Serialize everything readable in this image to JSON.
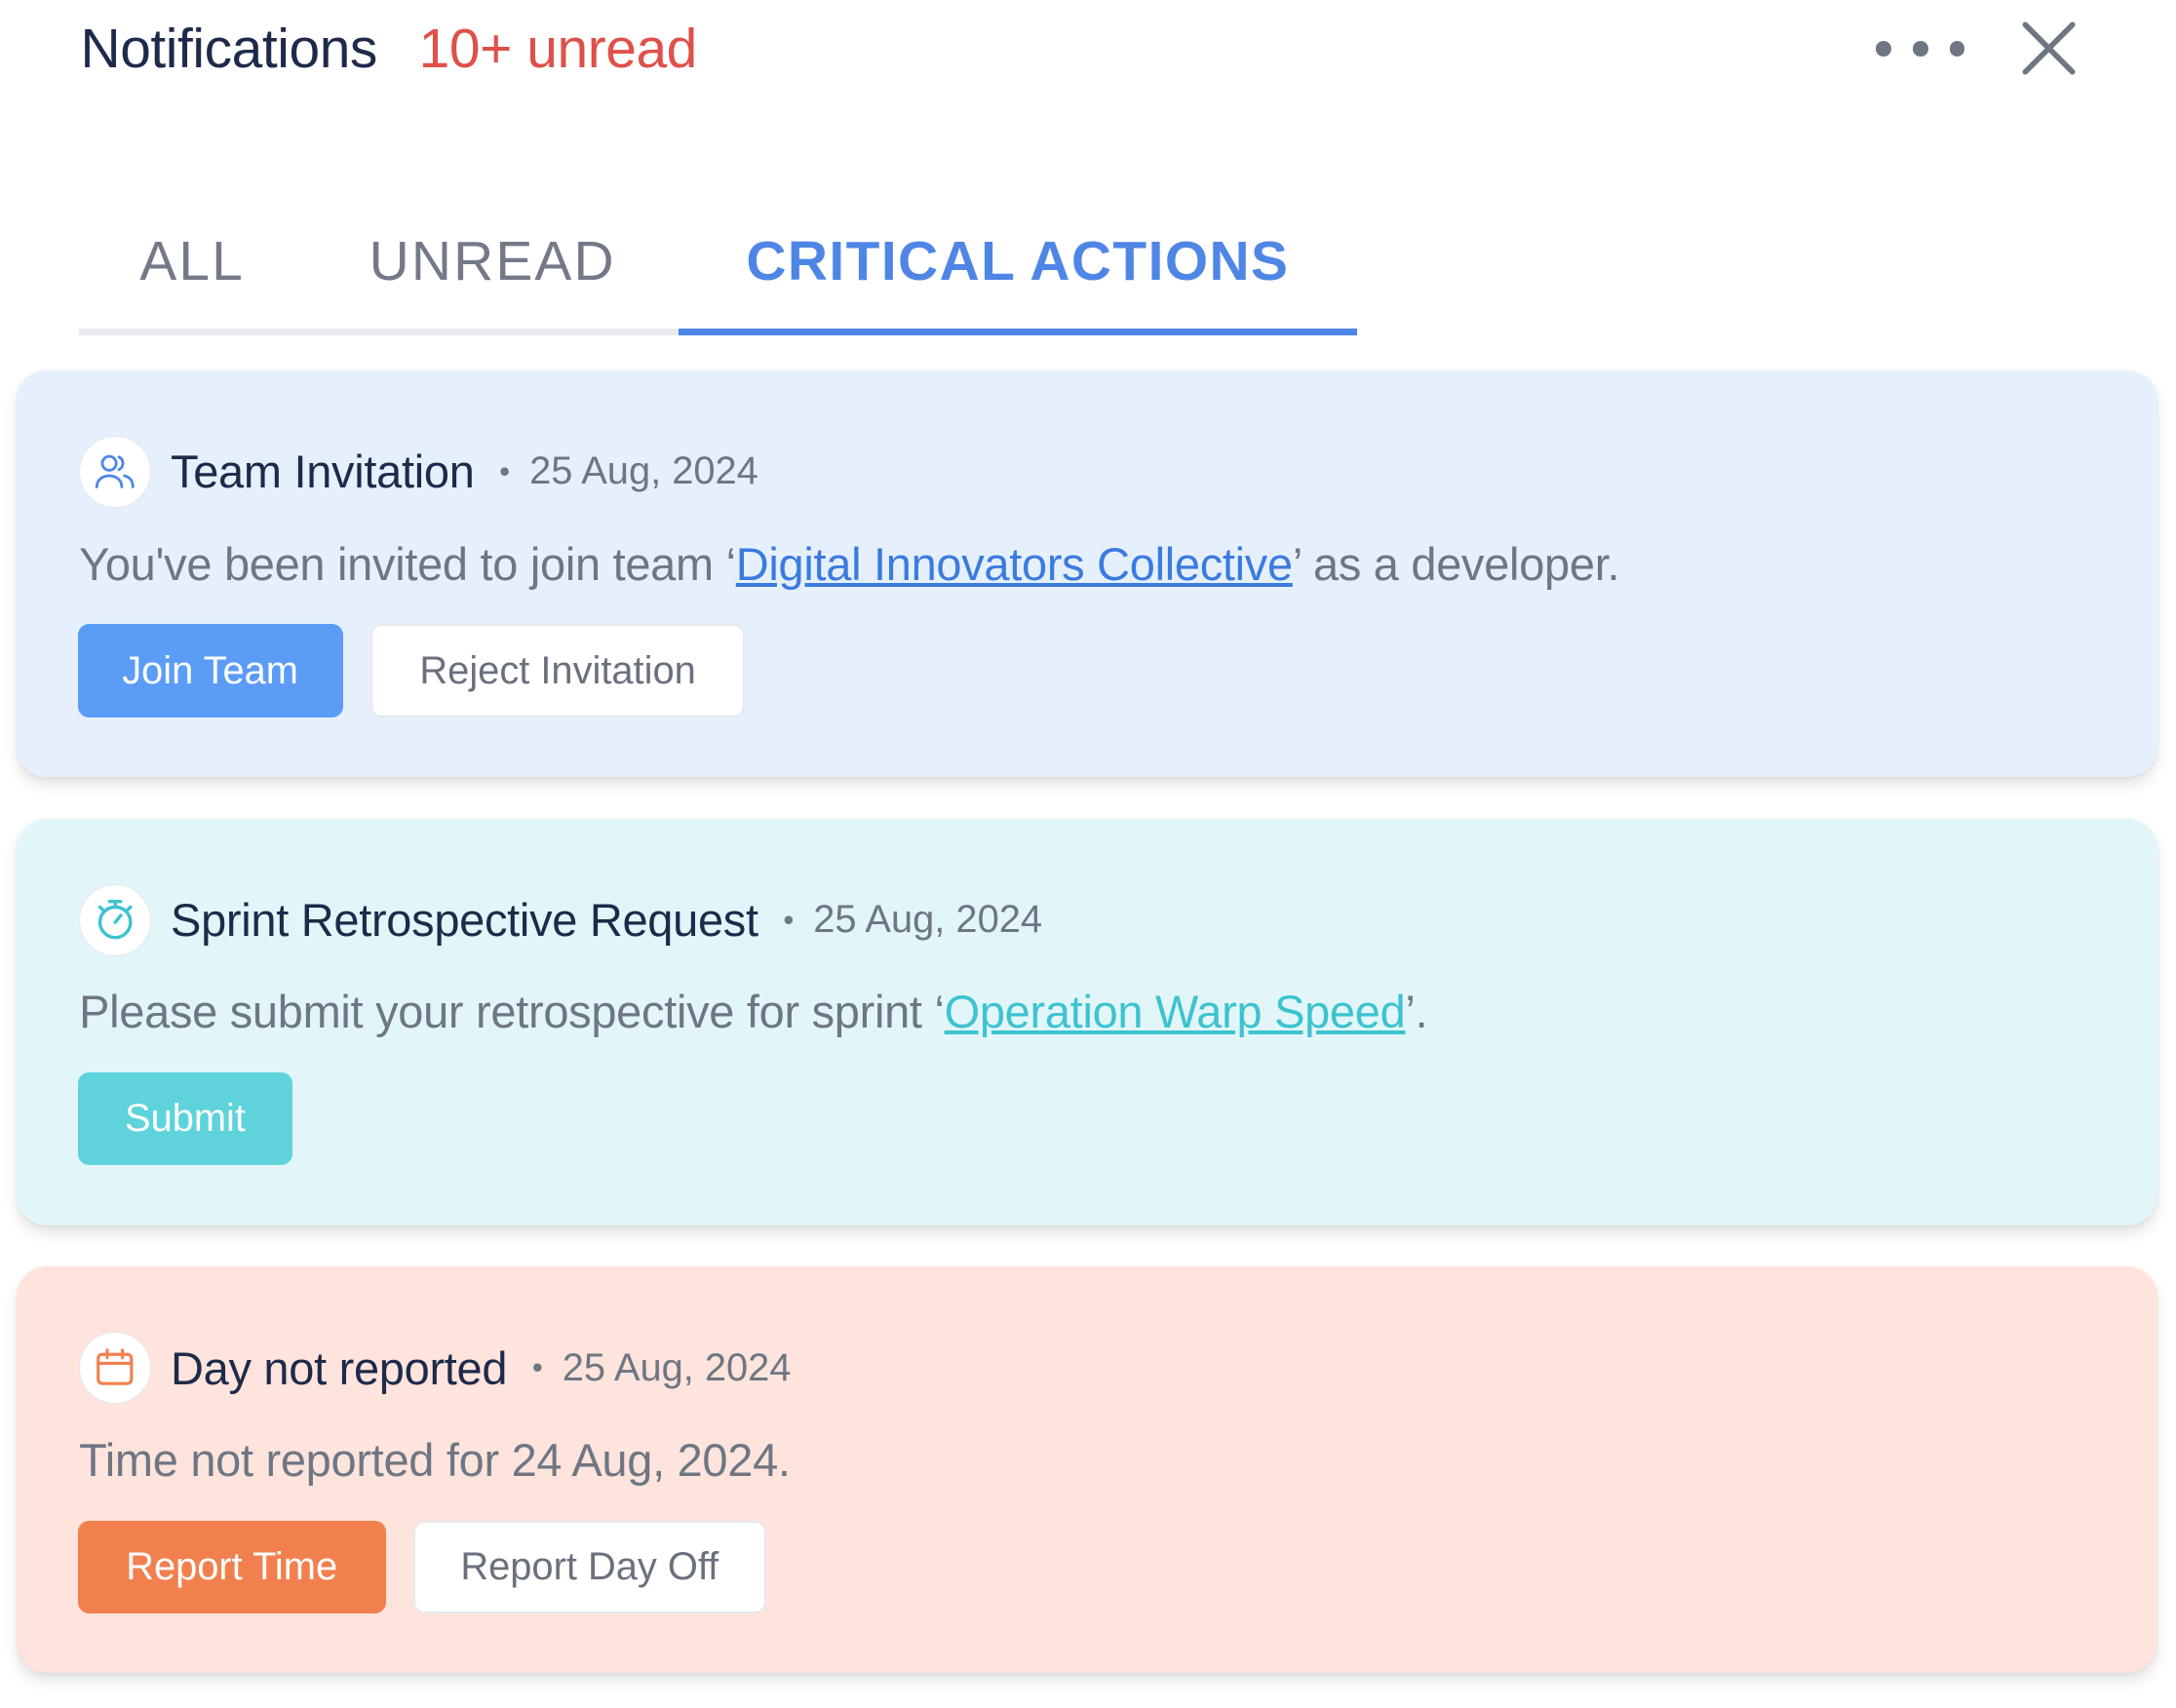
{
  "header": {
    "title": "Notifications",
    "unread_label": "10+ unread"
  },
  "icons": {
    "more": "more-horizontal-icon",
    "close": "close-icon",
    "team": "users-icon",
    "timer": "stopwatch-icon",
    "calendar": "calendar-icon"
  },
  "tabs": [
    {
      "label": "ALL",
      "active": false
    },
    {
      "label": "UNREAD",
      "active": false
    },
    {
      "label": "CRITICAL ACTIONS",
      "active": true
    }
  ],
  "colors": {
    "accent": "#4f86e6",
    "unread": "#e0504a",
    "team_card_bg": "#e6f0fd",
    "sprint_card_bg": "#e2f6fa",
    "day_card_bg": "#fee4dc",
    "join_button": "#5b9cf6",
    "submit_button": "#5ed3db",
    "report_button": "#f2804e"
  },
  "notifications": [
    {
      "title": "Team Invitation",
      "separator": "•",
      "date": "25 Aug, 2024",
      "message_prefix": "You've been invited to join team ‘",
      "link_text": "Digital Innovators Collective",
      "message_suffix": "’ as a developer.",
      "actions": [
        "Join Team",
        "Reject Invitation"
      ]
    },
    {
      "title": "Sprint Retrospective Request",
      "separator": "•",
      "date": "25 Aug, 2024",
      "message_prefix": "Please submit your retrospective for sprint ‘",
      "link_text": "Operation Warp Speed",
      "message_suffix": "’.",
      "actions": [
        "Submit"
      ]
    },
    {
      "title": "Day not reported",
      "separator": "•",
      "date": "25 Aug, 2024",
      "message": "Time not reported for 24 Aug, 2024.",
      "actions": [
        "Report Time",
        "Report Day Off"
      ]
    }
  ]
}
